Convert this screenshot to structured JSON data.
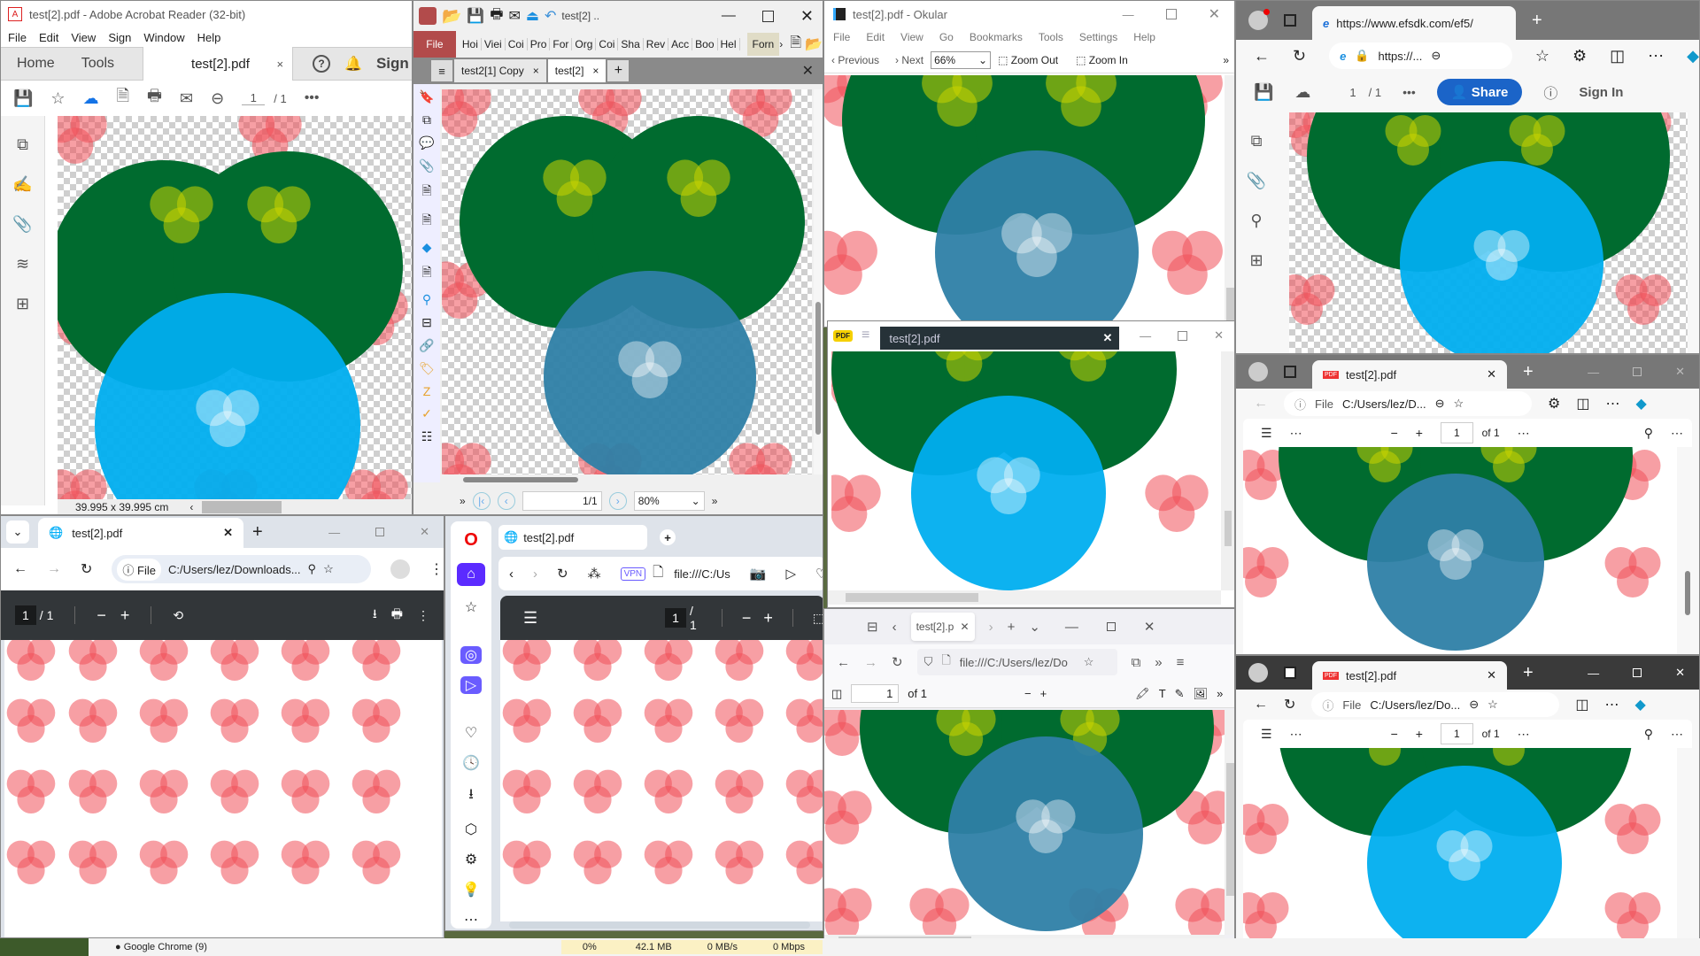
{
  "acrobat": {
    "title": "test[2].pdf - Adobe Acrobat Reader (32-bit)",
    "menu": [
      "File",
      "Edit",
      "View",
      "Sign",
      "Window",
      "Help"
    ],
    "tabs": {
      "home": "Home",
      "tools": "Tools",
      "doc": "test[2].pdf",
      "close": "×"
    },
    "sign_label": "Sign",
    "page_current": "1",
    "page_total": "/ 1",
    "status_size": "39.995 x 39.995 cm"
  },
  "foxit": {
    "title": "test[2] ..",
    "file_label": "File",
    "ribbon_tabs": [
      "Hoi",
      "Viei",
      "Coi",
      "Pro",
      "For",
      "Org",
      "Coi",
      "Sha",
      "Rev",
      "Acc",
      "Boo",
      "Hel"
    ],
    "form_tab": "Forn",
    "doc_tabs": [
      "test2[1] Copy",
      "test[2]"
    ],
    "page_display": "1/1",
    "zoom_value": "80%"
  },
  "okular": {
    "title": "test[2].pdf - Okular",
    "menu": [
      "File",
      "Edit",
      "View",
      "Go",
      "Bookmarks",
      "Tools",
      "Settings",
      "Help"
    ],
    "previous": "Previous",
    "next": "Next",
    "zoom_value": "66%",
    "zoom_out": "Zoom Out",
    "zoom_in": "Zoom In"
  },
  "sumatra": {
    "tab": "test[2].pdf",
    "logo": "PDF"
  },
  "edge_top": {
    "tab_url": "https://www.efsdk.com/ef5/",
    "address": "https://...",
    "page_current": "1",
    "page_total": "/ 1",
    "share": "Share",
    "sign_in": "Sign In"
  },
  "edge_mid": {
    "tab": "test[2].pdf",
    "file_chip": "File",
    "address": "C:/Users/lez/D...",
    "page_current": "1",
    "page_total": "of 1"
  },
  "edge_bot": {
    "tab": "test[2].pdf",
    "file_chip": "File",
    "address": "C:/Users/lez/Do...",
    "page_current": "1",
    "page_total": "of 1"
  },
  "chrome": {
    "tab": "test[2].pdf",
    "file_chip": "File",
    "address": "C:/Users/lez/Downloads...",
    "page_current": "1",
    "page_total": "/ 1"
  },
  "opera": {
    "tab": "test[2].pdf",
    "vpn": "VPN",
    "address": "file:///C:/Us",
    "page_current": "1",
    "page_total": "/ 1"
  },
  "firefox": {
    "tab": "test[2].p",
    "address": "file:///C:/Users/lez/Do",
    "page_current": "1",
    "page_total": "of 1"
  },
  "taskbar": {
    "chrome": "Google Chrome (9)",
    "cpu": "0%",
    "mem": "42.1 MB",
    "disk": "0 MB/s",
    "net": "0 Mbps"
  },
  "colors": {
    "dark_green": "#006b2f",
    "light_blue": "#00aeef",
    "teal_blue": "#2e7fa6",
    "red_dot": "#f0505a",
    "acrobat_blue": "#1473e6",
    "foxit_red": "#b24b4b",
    "opera_purple": "#5b2bff",
    "edge_share": "#1b64c8"
  }
}
